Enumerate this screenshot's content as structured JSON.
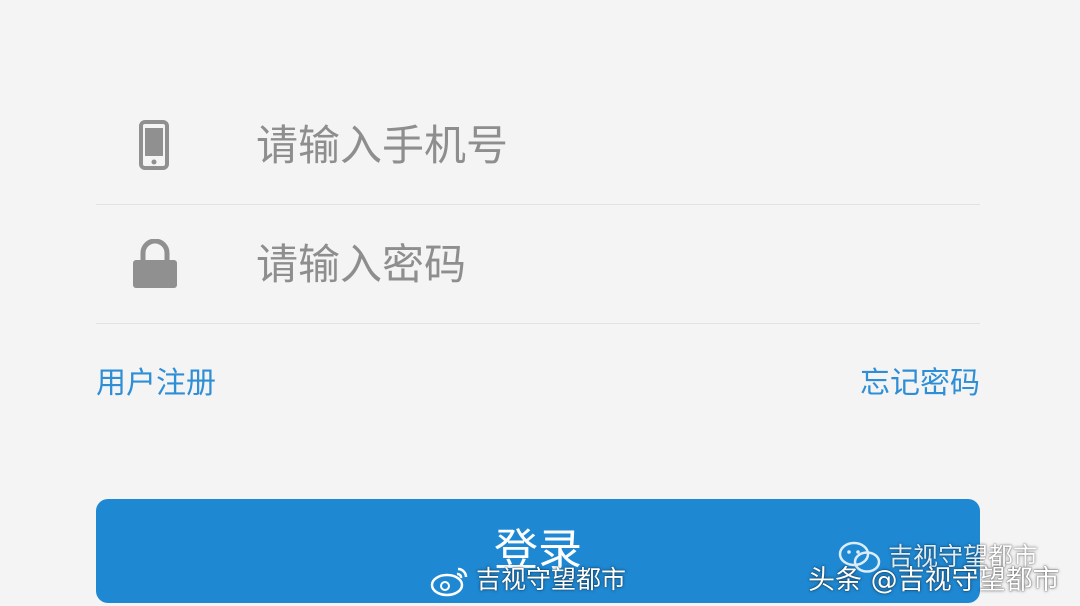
{
  "form": {
    "phone": {
      "icon": "mobile-phone-icon",
      "placeholder": "请输入手机号",
      "value": ""
    },
    "password": {
      "icon": "lock-icon",
      "placeholder": "请输入密码",
      "value": ""
    }
  },
  "links": {
    "register": "用户注册",
    "forgot_password": "忘记密码"
  },
  "login_button": {
    "label": "登录"
  },
  "watermarks": {
    "weibo": "吉视守望都市",
    "wechat": "吉视守望都市",
    "toutiao": "头条 @吉视守望都市"
  },
  "colors": {
    "background": "#f4f4f4",
    "accent": "#1e88d3",
    "link": "#2f8fd6",
    "icon": "#909090",
    "placeholder": "#8e8e8e"
  }
}
